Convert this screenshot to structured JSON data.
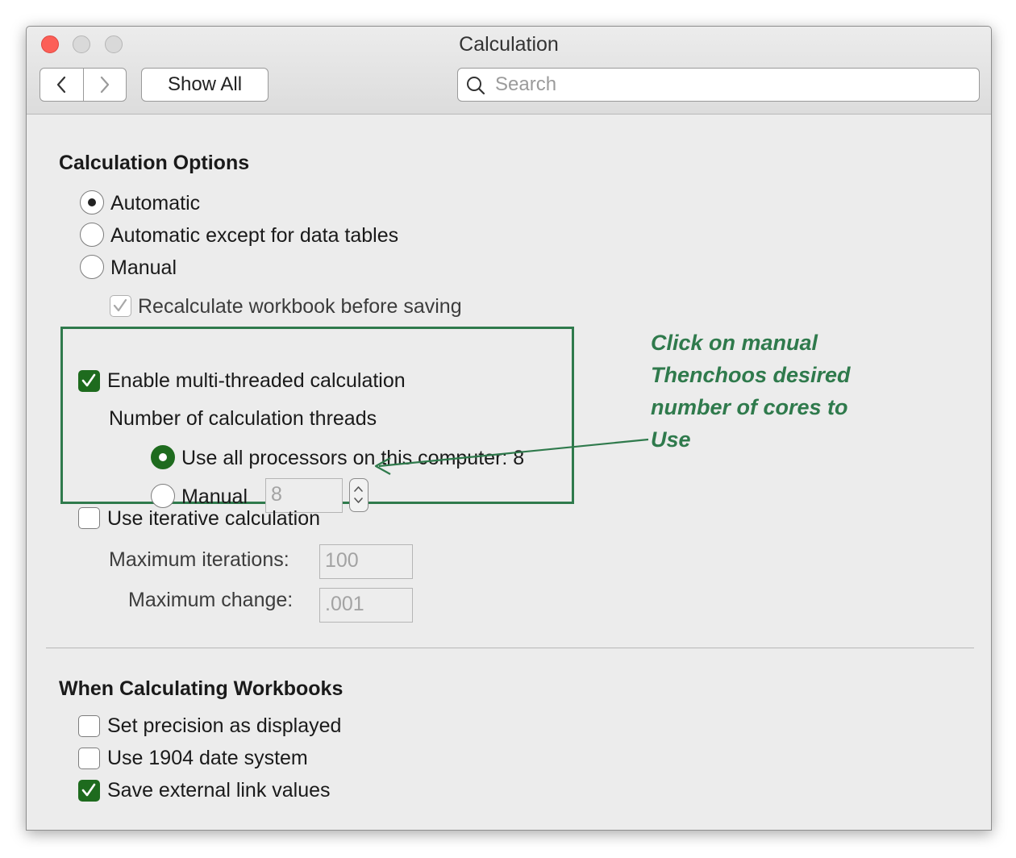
{
  "window": {
    "title": "Calculation",
    "toolbar": {
      "show_all_label": "Show All"
    },
    "search": {
      "placeholder": "Search",
      "value": ""
    }
  },
  "calc_options": {
    "heading": "Calculation Options",
    "mode_options": [
      {
        "label": "Automatic",
        "selected": true
      },
      {
        "label": "Automatic except for data tables",
        "selected": false
      },
      {
        "label": "Manual",
        "selected": false
      }
    ],
    "recalc_before_saving": {
      "label": "Recalculate workbook before saving",
      "checked": true,
      "enabled": false
    },
    "multi_thread": {
      "label": "Enable multi-threaded calculation",
      "checked": true,
      "threads_label": "Number of calculation threads",
      "use_all": {
        "label": "Use all processors on this computer: 8",
        "selected": true
      },
      "manual": {
        "label": "Manual",
        "selected": false,
        "value": "8"
      }
    },
    "iterative": {
      "label": "Use iterative calculation",
      "checked": false,
      "max_iterations_label": "Maximum iterations:",
      "max_iterations_value": "100",
      "max_change_label": "Maximum change:",
      "max_change_value": ".001"
    }
  },
  "workbooks": {
    "heading": "When Calculating Workbooks",
    "options": [
      {
        "label": "Set precision as displayed",
        "checked": false
      },
      {
        "label": "Use 1904 date system",
        "checked": false
      },
      {
        "label": "Save external link values",
        "checked": true
      }
    ]
  },
  "annotation": {
    "lines": [
      "Click on manual",
      "Thenchoos desired",
      "number of cores to",
      "Use"
    ],
    "color": "#2f7a4c"
  },
  "colors": {
    "accent_green": "#1e6b1e",
    "close_red": "#fc5f57"
  }
}
